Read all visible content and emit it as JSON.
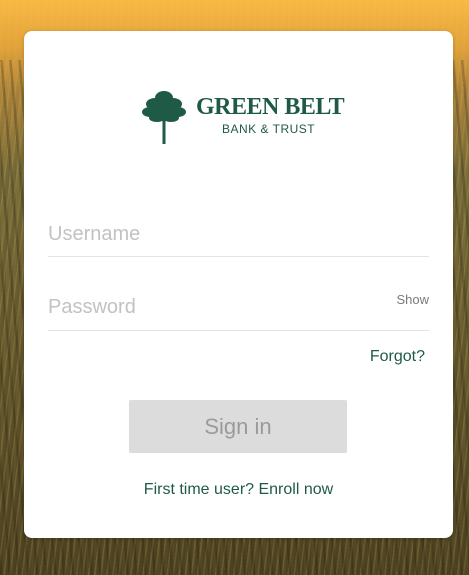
{
  "brand": {
    "name": "GREEN BELT",
    "subtitle": "BANK & TRUST",
    "logo_icon": "tree-icon",
    "color": "#1f5a47"
  },
  "login": {
    "username_placeholder": "Username",
    "username_value": "",
    "password_placeholder": "Password",
    "password_value": "",
    "show_label": "Show",
    "forgot_label": "Forgot?",
    "signin_label": "Sign in",
    "enroll_label": "First time user? Enroll now"
  },
  "colors": {
    "accent": "#1f5a47",
    "button_disabled_bg": "#dcdcdc",
    "button_disabled_text": "#9a9a9a",
    "placeholder": "#c2c2c2"
  }
}
